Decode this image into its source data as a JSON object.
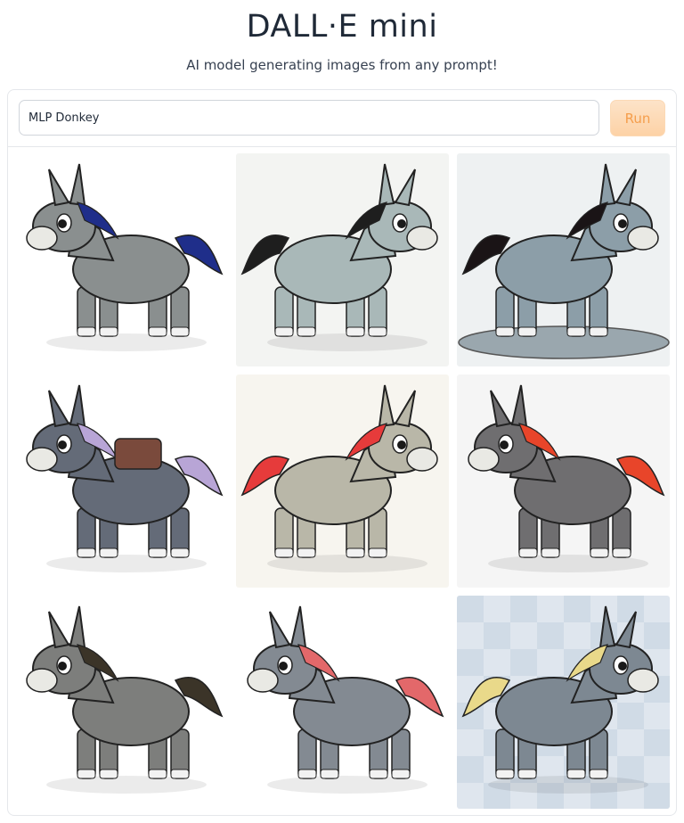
{
  "header": {
    "title": "DALL·E mini",
    "subtitle": "AI model generating images from any prompt!"
  },
  "prompt": {
    "value": "MLP Donkey"
  },
  "run_button": {
    "label": "Run"
  },
  "gallery": {
    "images": [
      {
        "name": "generated-image-1",
        "body": "#8a8f8f",
        "mane": "#1f2e8a",
        "bg": "#ffffff"
      },
      {
        "name": "generated-image-2",
        "body": "#a9b8b8",
        "mane": "#1e1e1e",
        "bg": "#f3f4f2"
      },
      {
        "name": "generated-image-3",
        "body": "#8c9ea8",
        "mane": "#1a1416",
        "bg": "#eef1f2"
      },
      {
        "name": "generated-image-4",
        "body": "#646b78",
        "mane": "#b8a5d6",
        "bg": "#ffffff"
      },
      {
        "name": "generated-image-5",
        "body": "#b9b7a8",
        "mane": "#e63b3b",
        "bg": "#f7f5ef"
      },
      {
        "name": "generated-image-6",
        "body": "#6f6e70",
        "mane": "#e8452a",
        "bg": "#f5f5f5"
      },
      {
        "name": "generated-image-7",
        "body": "#7d7e7c",
        "mane": "#3b3428",
        "bg": "#ffffff"
      },
      {
        "name": "generated-image-8",
        "body": "#838a92",
        "mane": "#e3686a",
        "bg": "#ffffff"
      },
      {
        "name": "generated-image-9",
        "body": "#7d8892",
        "mane": "#e9d98a",
        "bg": "#dfe6ee"
      }
    ]
  }
}
